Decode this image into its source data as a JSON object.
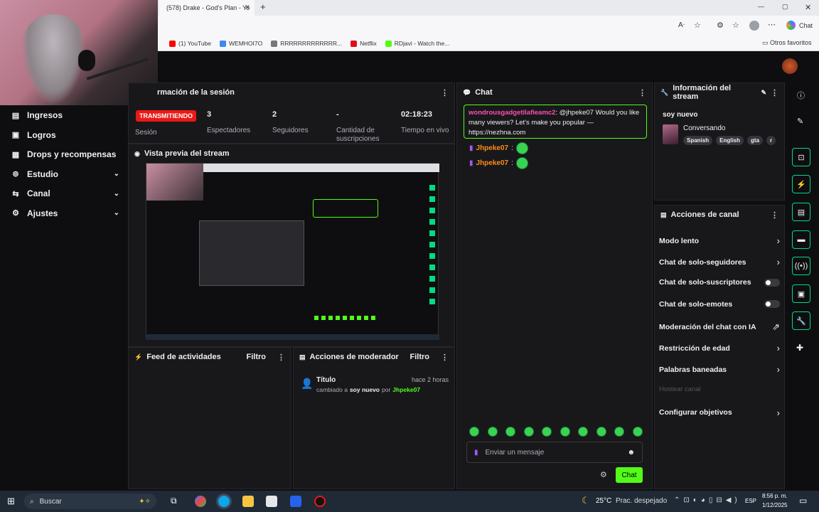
{
  "browser": {
    "tab_title": "(578) Drake - God's Plan - Yo",
    "new_tab": "+",
    "window_controls": [
      "—",
      "▢",
      "✕"
    ],
    "bookmarks": [
      {
        "label": "(1) YouTube",
        "color": "#ff0000"
      },
      {
        "label": "WEMHOI7O",
        "color": "#4285f4"
      },
      {
        "label": "RRRRRRRRRRRRR...",
        "color": "#777777"
      },
      {
        "label": "Netflix",
        "color": "#e50914"
      },
      {
        "label": "RDjavi - Watch the...",
        "color": "#53fc18"
      }
    ],
    "other_favorites": "Otros favoritos",
    "copilot_label": "Chat"
  },
  "sidebar": {
    "items": [
      {
        "label": "Ingresos",
        "icon": "money-icon",
        "glyph": "▤",
        "has_chevron": false
      },
      {
        "label": "Logros",
        "icon": "trophy-icon",
        "glyph": "▣",
        "has_chevron": false
      },
      {
        "label": "Drops y recompensas",
        "icon": "gift-icon",
        "glyph": "▦",
        "has_chevron": false
      },
      {
        "label": "Estudio",
        "icon": "studio-icon",
        "glyph": "⊚",
        "has_chevron": true
      },
      {
        "label": "Canal",
        "icon": "channel-icon",
        "glyph": "⇆",
        "has_chevron": true
      },
      {
        "label": "Ajustes",
        "icon": "gear-icon",
        "glyph": "⚙",
        "has_chevron": true
      }
    ],
    "chevron": "⌄"
  },
  "session": {
    "title": "rmación de la sesión",
    "live_badge": "TRANSMITIENDO",
    "session_label": "Sesión",
    "stats": [
      {
        "value": "3",
        "label": "Espectadores"
      },
      {
        "value": "2",
        "label": "Seguidores"
      },
      {
        "value": "-",
        "label": "Cantidad de suscripciones"
      },
      {
        "value": "02:18:23",
        "label": "Tiempo en vivo"
      }
    ]
  },
  "preview": {
    "title": "Vista previa del stream"
  },
  "activity": {
    "title": "Feed de actividades",
    "filter": "Filtro"
  },
  "modactions": {
    "title": "Acciones de moderador",
    "filter": "Filtro",
    "entry": {
      "title": "Título",
      "time": "hace 2 horas",
      "changed_to": "cambiado a",
      "value": "soy nuevo",
      "by": "por",
      "user": "Jhpeke07"
    }
  },
  "chat": {
    "title": "Chat",
    "highlight": {
      "user": "wondrousgadgetilafieamc2",
      "text": ": @jhpeke07 Would you like many viewers? Let's make you popular — https://nezhna.com"
    },
    "messages": [
      {
        "user": "Jhpeke07",
        "color": "#ff8c1a"
      },
      {
        "user": "Jhpeke07",
        "color": "#ff8c1a"
      }
    ],
    "input_placeholder": "Enviar un mensaje",
    "send_label": "Chat",
    "emote_count": 10
  },
  "stream_info": {
    "title": "Información del stream",
    "stream_title": "soy nuevo",
    "category": "Conversando",
    "tags": [
      "Spanish",
      "English",
      "gta",
      "r"
    ]
  },
  "channel_actions": {
    "title": "Acciones de canal",
    "items": [
      {
        "label": "Modo lento",
        "control": "›"
      },
      {
        "label": "Chat de solo-seguidores",
        "control": "›"
      },
      {
        "label": "Chat de solo-suscriptores",
        "control": "toggle"
      },
      {
        "label": "Chat de solo-emotes",
        "control": "toggle"
      },
      {
        "label": "Moderación del chat con IA",
        "control": "⇗"
      },
      {
        "label": "Restricción de edad",
        "control": "›"
      },
      {
        "label": "Palabras baneadas",
        "control": "›"
      },
      {
        "label": "Hostear canal",
        "control": "disabled"
      },
      {
        "label": "Configurar objetivos",
        "control": "›"
      }
    ]
  },
  "taskbar": {
    "search_label": "Buscar",
    "weather": "25°C",
    "weather_desc": "Prac. despejado",
    "lang": "ESP",
    "time": "8:56 p. m.",
    "date": "1/12/2025"
  },
  "colors": {
    "accent": "#53fc18",
    "live": "#e91916",
    "rail_border": "#00db84",
    "panel": "#18181b"
  }
}
